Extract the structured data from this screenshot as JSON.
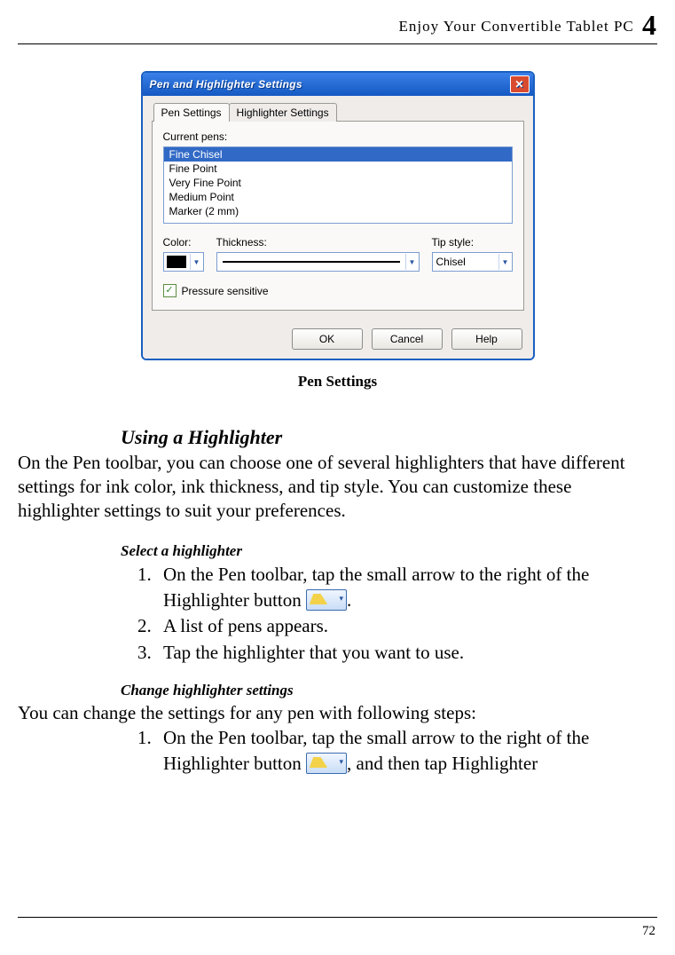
{
  "header": {
    "title": "Enjoy Your Convertible Tablet PC",
    "chapter_num": "4"
  },
  "dialog": {
    "title": "Pen and Highlighter Settings",
    "tabs": [
      "Pen Settings",
      "Highlighter Settings"
    ],
    "current_pens_label": "Current pens:",
    "pens": [
      "Fine Chisel",
      "Fine Point",
      "Very Fine Point",
      "Medium Point",
      "Marker (2 mm)"
    ],
    "color_label": "Color:",
    "thickness_label": "Thickness:",
    "tip_label": "Tip style:",
    "tip_value": "Chisel",
    "pressure_label": "Pressure sensitive",
    "ok": "OK",
    "cancel": "Cancel",
    "help": "Help"
  },
  "caption": "Pen Settings",
  "section_heading": "Using a Highlighter",
  "section_body": "On the Pen toolbar, you can choose one of several highlighters that have different settings for ink color, ink thickness, and tip style. You can customize these highlighter settings to suit your preferences.",
  "subA_heading": "Select a highlighter",
  "subA_steps": {
    "s1a": "On the Pen toolbar, tap the small arrow to the right of the Highlighter button ",
    "s1b": ".",
    "s2": "A list of pens appears.",
    "s3": "Tap the highlighter that you want to use."
  },
  "subB_heading": "Change highlighter settings",
  "subB_intro": "You can change the settings for any pen with following steps:",
  "subB_steps": {
    "s1a": "On the Pen toolbar, tap the small arrow to the right of the Highlighter button ",
    "s1b": ", and then tap Highlighter"
  },
  "page_number": "72"
}
